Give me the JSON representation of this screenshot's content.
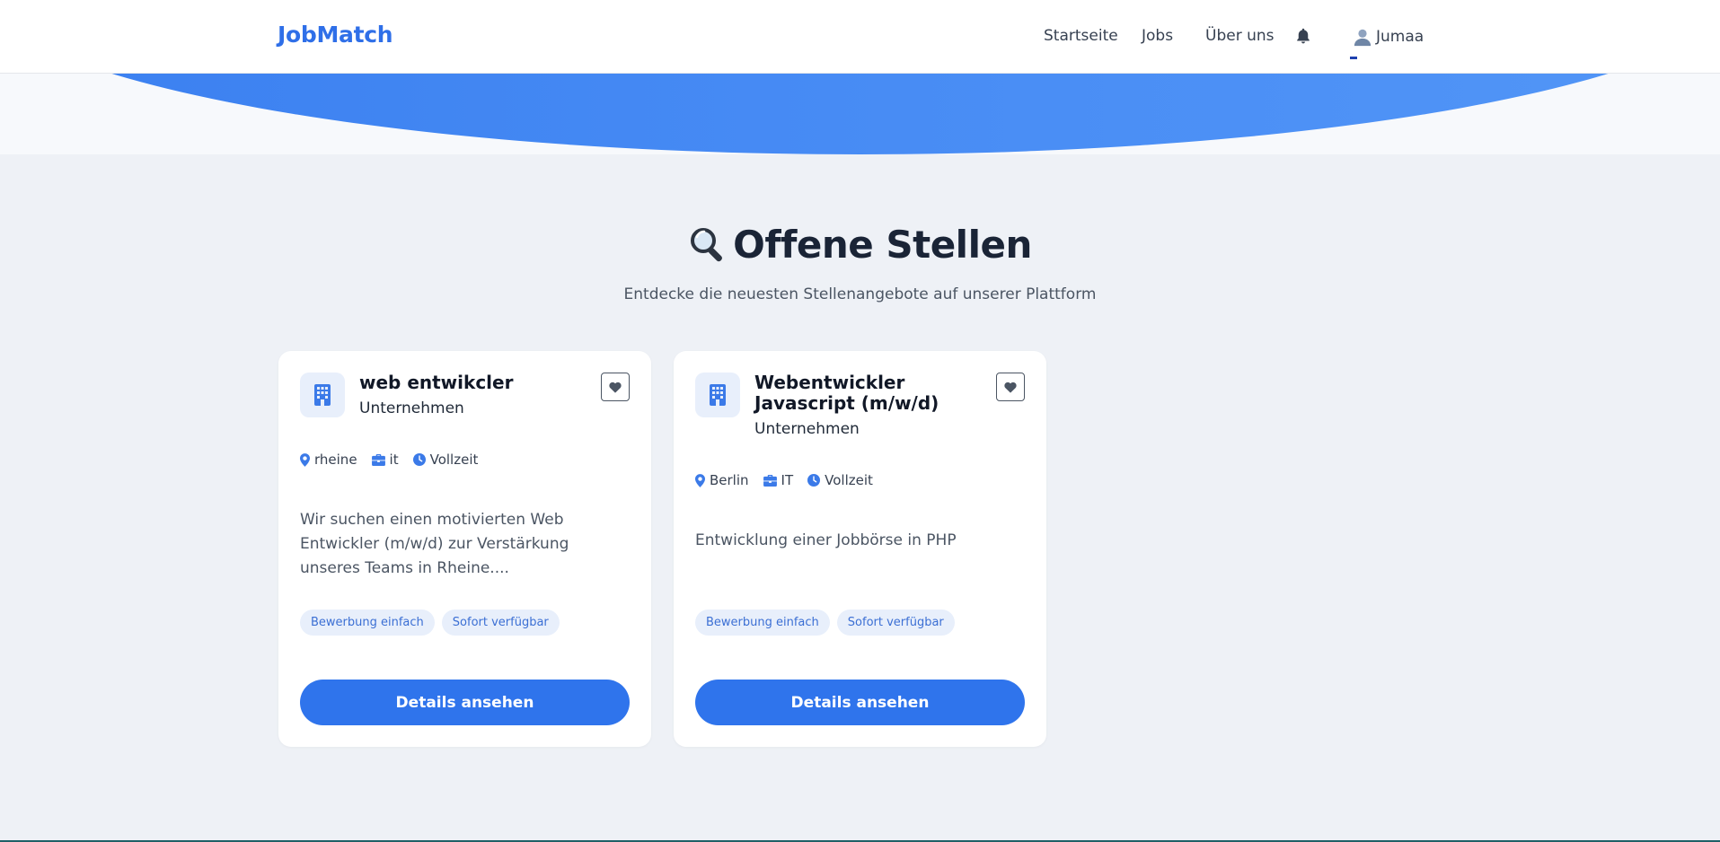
{
  "header": {
    "brand": "JobMatch",
    "nav": [
      "Startseite",
      "Jobs",
      "Über uns"
    ],
    "user_name": "Jumaa"
  },
  "page": {
    "title": "Offene Stellen",
    "subtitle": "Entdecke die neuesten Stellenangebote auf unserer Plattform"
  },
  "jobs": [
    {
      "title": "web entwikcler",
      "company": "Unternehmen",
      "location": "rheine",
      "category": "it",
      "type": "Vollzeit",
      "description": "Wir suchen einen motivierten Web Entwickler (m/w/d) zur Verstärkung unseres Teams in Rheine....",
      "tags": [
        "Bewerbung einfach",
        "Sofort verfügbar"
      ],
      "button": "Details ansehen"
    },
    {
      "title": "Webentwickler Javascript (m/w/d)",
      "company": "Unternehmen",
      "location": "Berlin",
      "category": "IT",
      "type": "Vollzeit",
      "description": "Entwicklung einer Jobbörse in PHP",
      "tags": [
        "Bewerbung einfach",
        "Sofort verfügbar"
      ],
      "button": "Details ansehen"
    }
  ],
  "colors": {
    "brand": "#2f6fe8",
    "primary_button": "#2f74ec",
    "hero": "#3a7ff0",
    "background": "#eef1f6"
  },
  "icons": [
    "bell-icon",
    "user-icon",
    "search-icon",
    "building-icon",
    "heart-icon",
    "location-pin-icon",
    "briefcase-icon",
    "clock-icon"
  ]
}
